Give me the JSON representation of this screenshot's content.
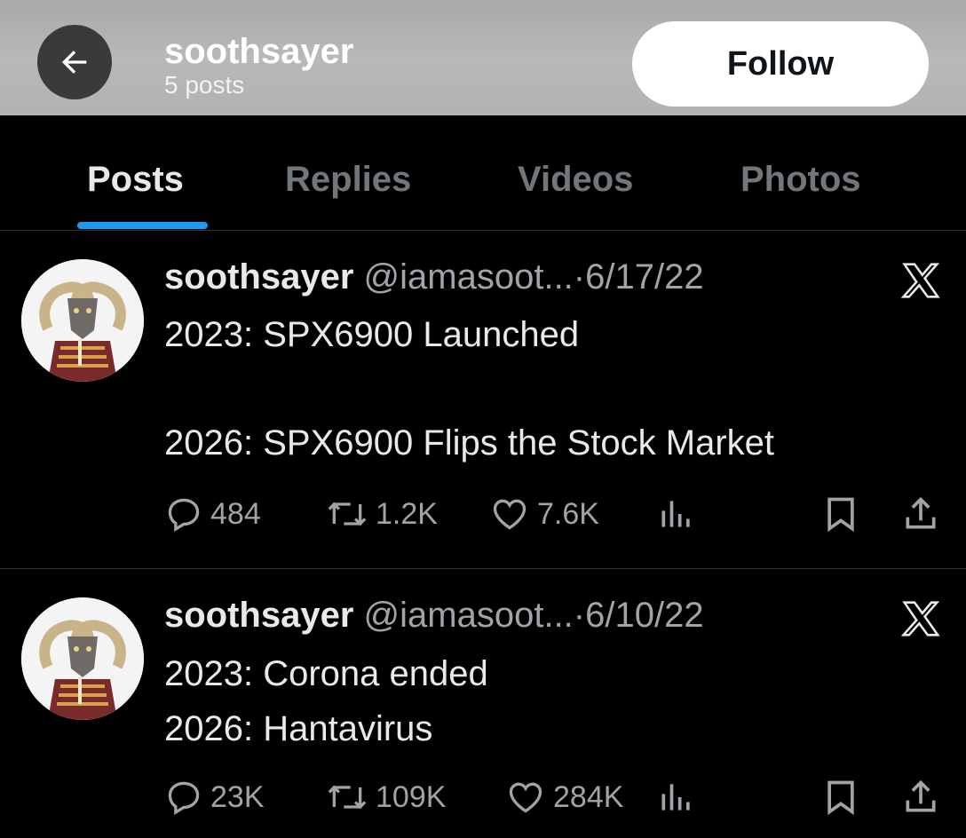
{
  "header": {
    "title": "soothsayer",
    "subtitle": "5 posts",
    "follow_label": "Follow",
    "back_icon": "arrow-left-icon",
    "background": "#b1b1b1"
  },
  "tabs": [
    {
      "label": "Posts",
      "active": true
    },
    {
      "label": "Replies",
      "active": false
    },
    {
      "label": "Videos",
      "active": false
    },
    {
      "label": "Photos",
      "active": false
    }
  ],
  "accent_color": "#1d9bf0",
  "posts": [
    {
      "name": "soothsayer",
      "handle_date": "@iamasoot...·6/17/22",
      "lines": [
        "2023: SPX6900 Launched",
        "",
        "2026: SPX6900 Flips the Stock Market"
      ],
      "replies": "484",
      "reposts": "1.2K",
      "likes": "7.6K",
      "source_icon": "x-logo-icon"
    },
    {
      "name": "soothsayer",
      "handle_date": "@iamasoot...·6/10/22",
      "lines": [
        "2023: Corona ended",
        "2026: Hantavirus"
      ],
      "replies": "23K",
      "reposts": "109K",
      "likes": "284K",
      "source_icon": "x-logo-icon"
    }
  ]
}
